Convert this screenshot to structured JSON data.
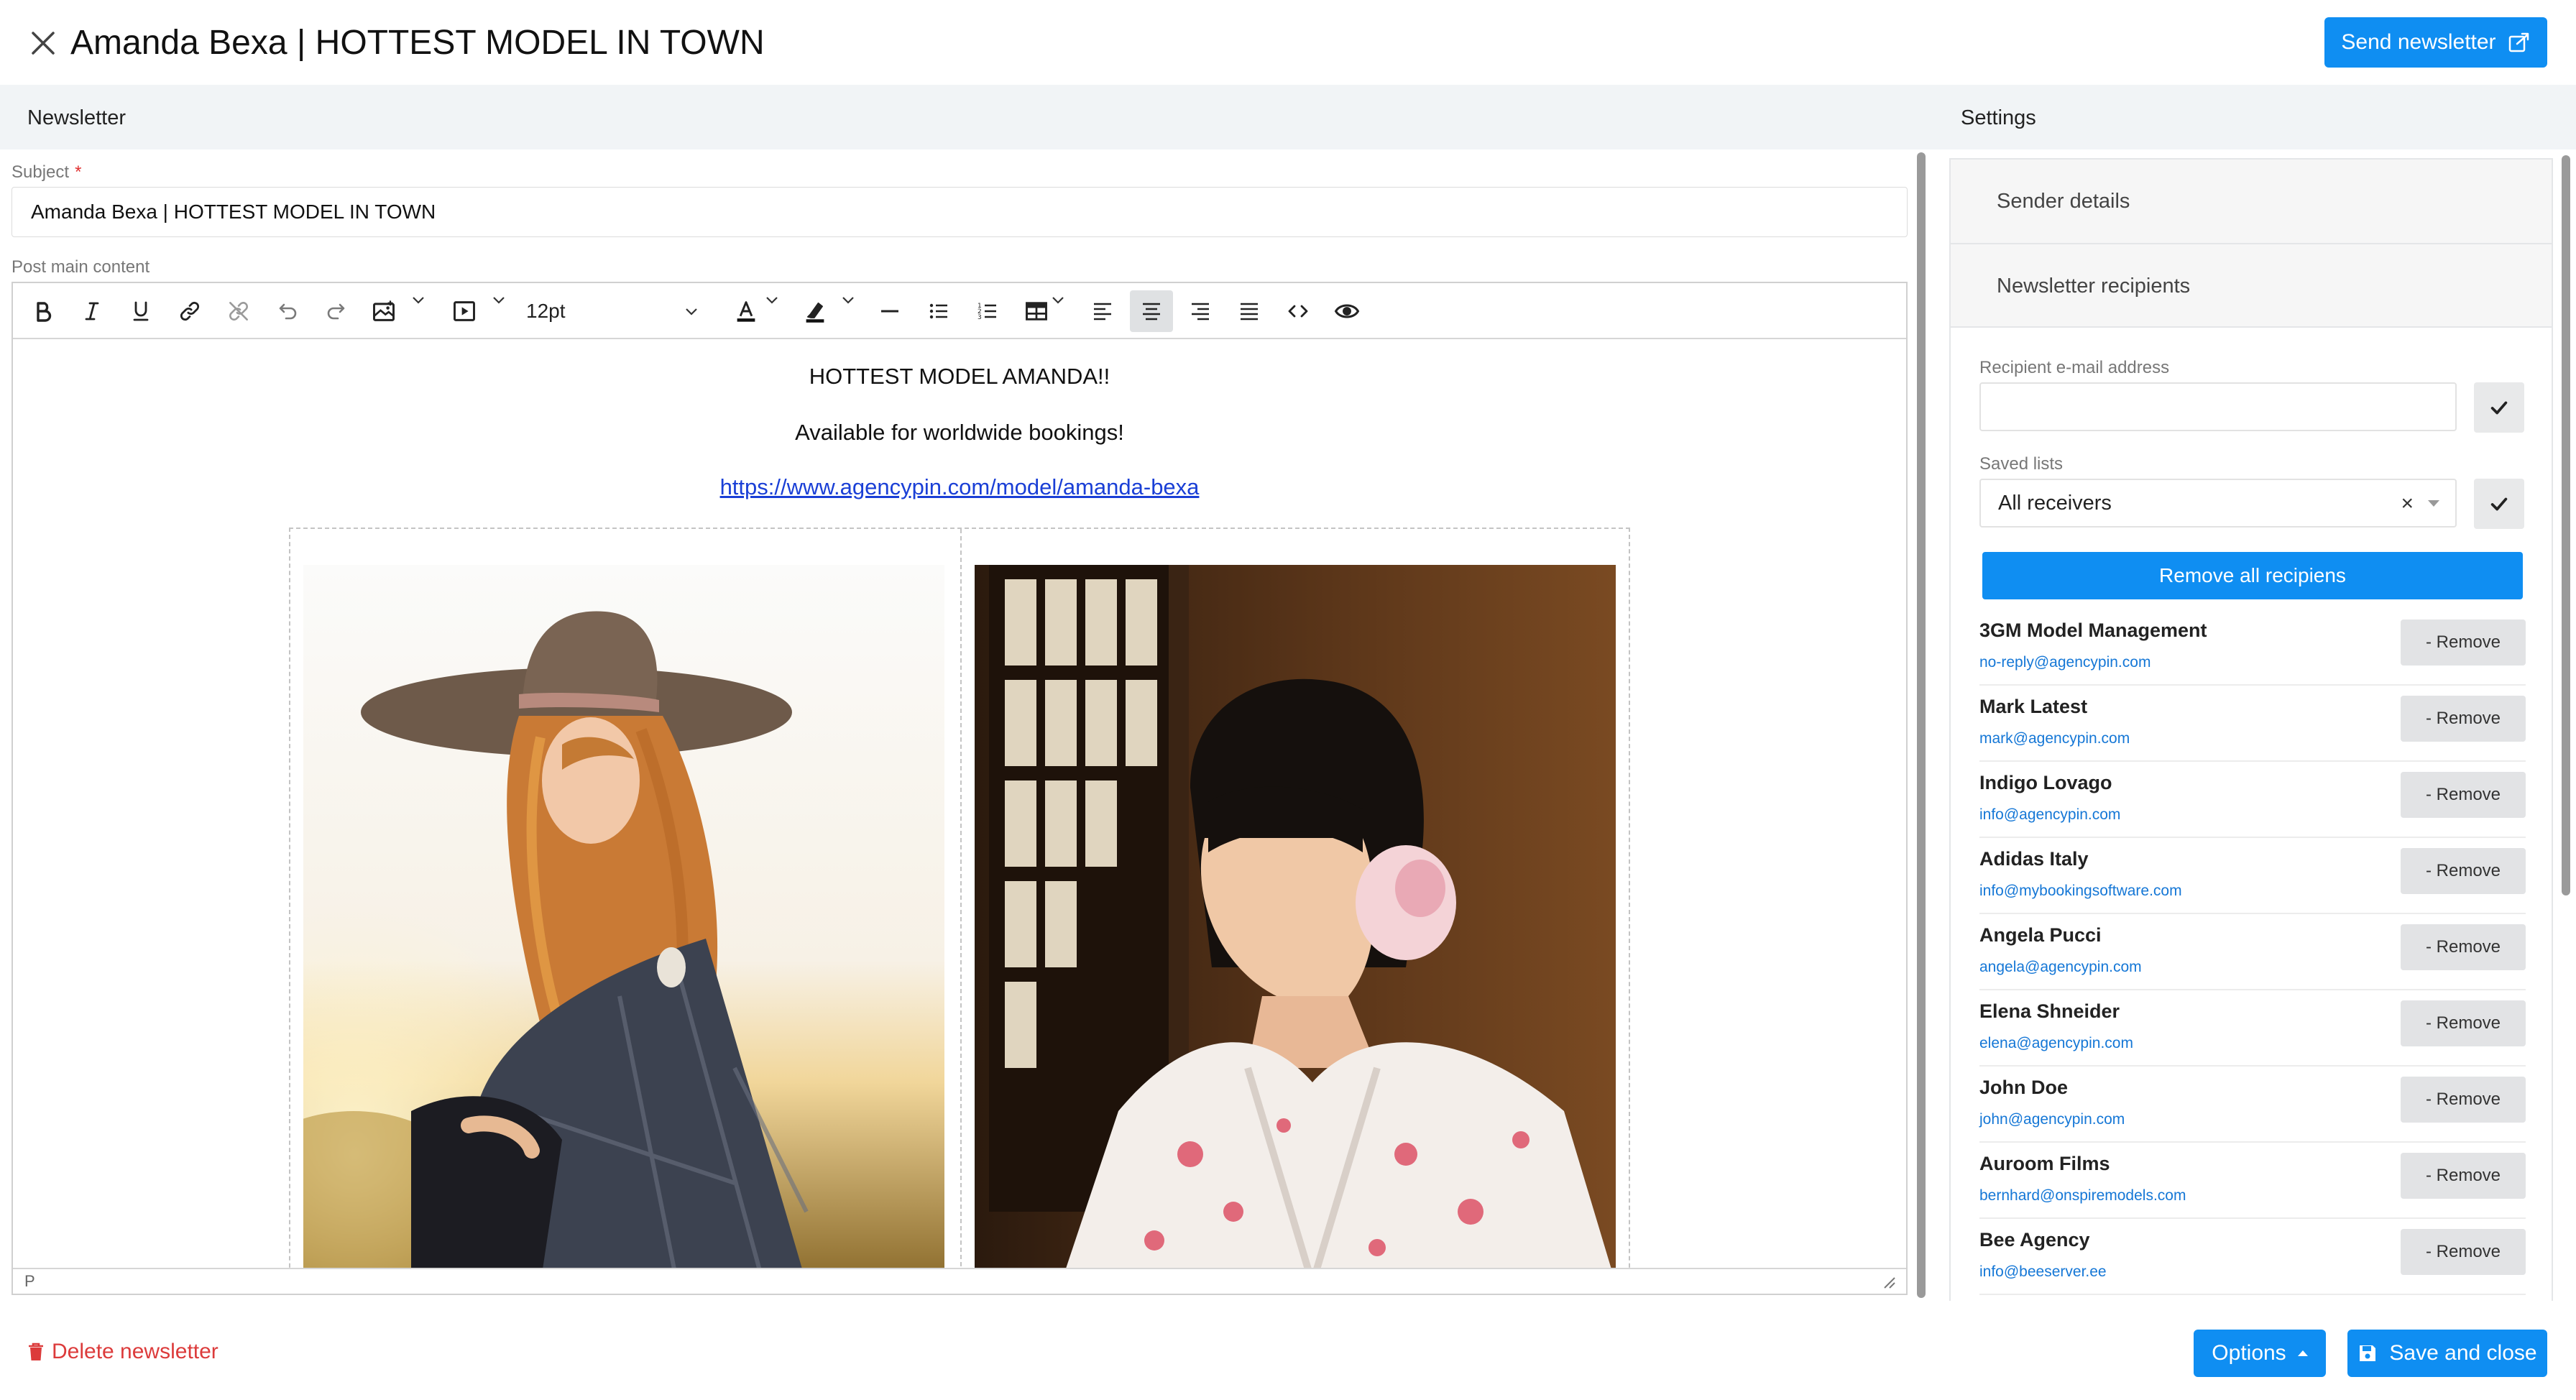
{
  "header": {
    "title": "Amanda Bexa | HOTTEST MODEL IN TOWN",
    "send_label": "Send newsletter"
  },
  "sections": {
    "left_title": "Newsletter",
    "right_title": "Settings"
  },
  "subject": {
    "label": "Subject",
    "required_mark": "*",
    "value": "Amanda Bexa | HOTTEST MODEL IN TOWN"
  },
  "editor": {
    "label": "Post main content",
    "font_size": "12pt",
    "status_tag": "P",
    "toolbar_icons": [
      "bold-icon",
      "italic-icon",
      "underline-icon",
      "link-icon",
      "unlink-icon",
      "undo-icon",
      "redo-icon",
      "image-icon",
      "media-icon",
      "font-color-icon",
      "highlight-icon",
      "horizontal-rule-icon",
      "bullet-list-icon",
      "numbered-list-icon",
      "table-icon",
      "align-left-icon",
      "align-center-icon",
      "align-right-icon",
      "align-justify-icon",
      "code-icon",
      "preview-icon"
    ],
    "content": {
      "headline": "HOTTEST MODEL AMANDA!!",
      "subline": "Available for worldwide bookings!",
      "link": "https://www.agencypin.com/model/amanda-bexa"
    }
  },
  "settings": {
    "accordion": [
      "Sender details",
      "Newsletter recipients"
    ],
    "recipient_email_label": "Recipient e-mail address",
    "recipient_email_value": "",
    "saved_lists_label": "Saved lists",
    "saved_list_value": "All receivers",
    "clear_symbol": "×",
    "remove_all_label": "Remove all recipiens",
    "remove_label": "- Remove",
    "recipients": [
      {
        "name": "3GM Model Management",
        "email": "no-reply@agencypin.com"
      },
      {
        "name": "Mark Latest",
        "email": "mark@agencypin.com"
      },
      {
        "name": "Indigo Lovago",
        "email": "info@agencypin.com"
      },
      {
        "name": "Adidas Italy",
        "email": "info@mybookingsoftware.com"
      },
      {
        "name": "Angela Pucci",
        "email": "angela@agencypin.com"
      },
      {
        "name": "Elena Shneider",
        "email": "elena@agencypin.com"
      },
      {
        "name": "John Doe",
        "email": "john@agencypin.com"
      },
      {
        "name": "Auroom Films",
        "email": "bernhard@onspiremodels.com"
      },
      {
        "name": "Bee Agency",
        "email": "info@beeserver.ee"
      }
    ]
  },
  "footer": {
    "delete_label": "Delete newsletter",
    "options_label": "Options",
    "save_label": "Save and close"
  },
  "colors": {
    "primary": "#0f8ef2",
    "danger": "#dc3b3b",
    "link": "#1a3fd6",
    "email": "#1577d6",
    "section_bg": "#f1f4f6"
  }
}
